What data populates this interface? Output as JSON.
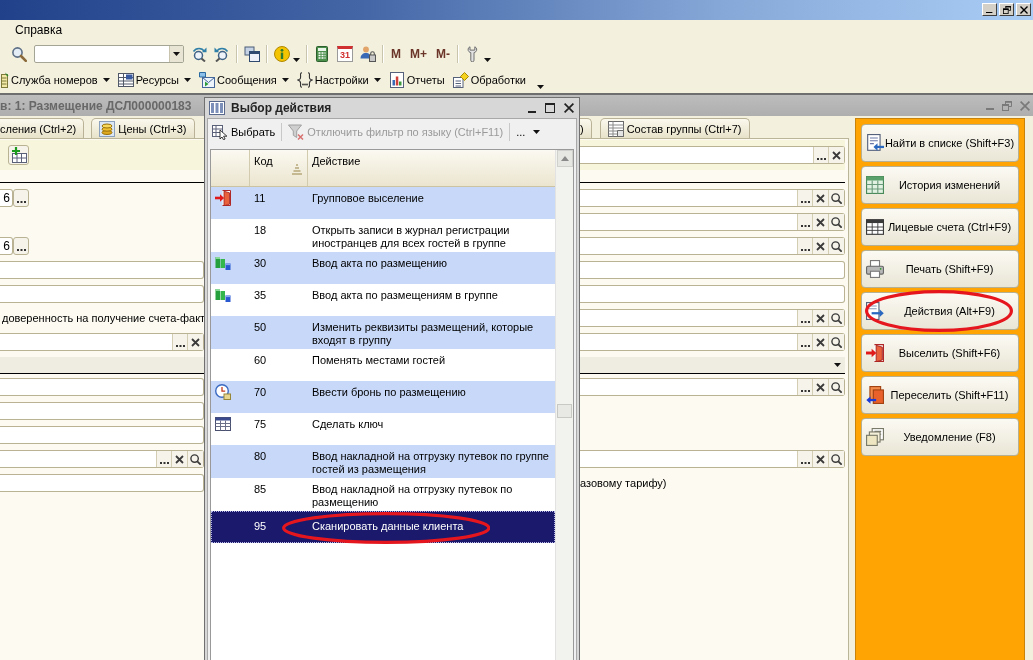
{
  "window": {
    "buttons": [
      {
        "kind": "minimize"
      },
      {
        "kind": "restore"
      },
      {
        "kind": "close"
      }
    ]
  },
  "menu": [
    {
      "label": "Справка"
    }
  ],
  "toolbar": {
    "groups": [
      [
        {
          "kind": "search",
          "dropdown": false
        },
        {
          "kind": "combo",
          "dropdown": true
        },
        {
          "kind": "findnext",
          "dropdown": false
        },
        {
          "kind": "findprev",
          "dropdown": false
        }
      ],
      [
        {
          "kind": "windows",
          "dropdown": false
        }
      ],
      [
        {
          "kind": "info",
          "dropdown": true
        }
      ],
      [
        {
          "kind": "calculator",
          "dropdown": false
        },
        {
          "kind": "calendar",
          "label": "31",
          "dropdown": false
        },
        {
          "kind": "users",
          "dropdown": false
        }
      ],
      [
        {
          "kind": "memory",
          "label": "M",
          "dropdown": false
        },
        {
          "kind": "memory",
          "label": "M+",
          "dropdown": false
        },
        {
          "kind": "memory",
          "label": "M-",
          "dropdown": false
        }
      ],
      [
        {
          "kind": "tools",
          "dropdown": true
        }
      ]
    ]
  },
  "menu_toolbar": {
    "items": [
      {
        "kind": "rooms",
        "label": "Служба номеров",
        "dropdown": true
      },
      {
        "kind": "resources",
        "label": "Ресурсы",
        "dropdown": true
      },
      {
        "kind": "messages",
        "label": "Сообщения",
        "dropdown": true
      },
      {
        "kind": "settings",
        "label": "Настройки",
        "dropdown": true
      },
      {
        "kind": "reports",
        "label": "Отчеты",
        "dropdown": false
      },
      {
        "kind": "processing",
        "label": "Обработки",
        "dropdown": false
      }
    ],
    "overflow": true
  },
  "document": {
    "title": "в: 1: Размещение ДСЛ000000183",
    "buttons": [
      {
        "kind": "minimize"
      },
      {
        "kind": "restore"
      },
      {
        "kind": "close"
      }
    ],
    "tabs": {
      "left": [
        {
          "kind": "plain",
          "label": "сления (Ctrl+2)",
          "selected": false
        },
        {
          "kind": "prices",
          "label": "Цены (Ctrl+3)",
          "selected": false
        }
      ],
      "right": [
        {
          "kind": "plain",
          "label": ")",
          "selected": false
        },
        {
          "kind": "table",
          "label": "Состав группы (Ctrl+7)",
          "selected": false
        }
      ]
    },
    "form": {
      "rows": [
        {
          "kind": "toolbar",
          "left": {
            "kind": "buttons",
            "buttons": [
              {
                "kind": "add"
              }
            ]
          },
          "right": {
            "kind": "input",
            "buttons": [
              {
                "kind": "select"
              },
              {
                "kind": "clear"
              }
            ]
          }
        },
        {
          "kind": "field",
          "left": {
            "kind": "number",
            "value": "6",
            "buttons": [
              {
                "kind": "select"
              }
            ]
          },
          "right": {
            "kind": "input",
            "buttons": [
              {
                "kind": "select"
              },
              {
                "kind": "clear"
              },
              {
                "kind": "search"
              }
            ]
          }
        },
        {
          "kind": "field",
          "right": {
            "kind": "input",
            "buttons": [
              {
                "kind": "select"
              },
              {
                "kind": "clear"
              },
              {
                "kind": "search"
              }
            ]
          }
        },
        {
          "kind": "field",
          "left": {
            "kind": "number",
            "value": "6",
            "buttons": [
              {
                "kind": "select"
              }
            ]
          },
          "right": {
            "kind": "input",
            "buttons": [
              {
                "kind": "select"
              },
              {
                "kind": "clear"
              },
              {
                "kind": "search"
              }
            ]
          }
        },
        {
          "kind": "field",
          "left": {
            "kind": "input"
          },
          "right": {
            "kind": "input"
          }
        },
        {
          "kind": "field",
          "left": {
            "kind": "input"
          },
          "right": {
            "kind": "input"
          }
        },
        {
          "kind": "field",
          "left": {
            "kind": "text",
            "text": "доверенность на получение счета-факт"
          },
          "right": {
            "kind": "input",
            "buttons": [
              {
                "kind": "select"
              },
              {
                "kind": "clear"
              },
              {
                "kind": "search"
              }
            ]
          }
        },
        {
          "kind": "field",
          "left": {
            "kind": "input",
            "buttons": [
              {
                "kind": "select"
              },
              {
                "kind": "clear"
              }
            ]
          },
          "right": {
            "kind": "input",
            "buttons": [
              {
                "kind": "select"
              },
              {
                "kind": "clear"
              },
              {
                "kind": "search"
              }
            ]
          }
        },
        {
          "kind": "band",
          "left": {
            "kind": "band",
            "dropdown": false
          },
          "right": {
            "kind": "band",
            "dropdown": true
          }
        },
        {
          "kind": "field",
          "left": {
            "kind": "input"
          },
          "right": {
            "kind": "input",
            "buttons": [
              {
                "kind": "select"
              },
              {
                "kind": "clear"
              },
              {
                "kind": "search"
              }
            ]
          }
        },
        {
          "kind": "field",
          "left": {
            "kind": "input"
          }
        },
        {
          "kind": "field",
          "left": {
            "kind": "input"
          }
        },
        {
          "kind": "field",
          "left": {
            "kind": "input",
            "buttons": [
              {
                "kind": "select"
              },
              {
                "kind": "clear"
              },
              {
                "kind": "search"
              }
            ]
          },
          "right": {
            "kind": "input",
            "buttons": [
              {
                "kind": "select"
              },
              {
                "kind": "clear"
              },
              {
                "kind": "search"
              }
            ]
          }
        },
        {
          "kind": "field",
          "left": {
            "kind": "input"
          },
          "right": {
            "kind": "text",
            "text": "азовому тарифу)"
          }
        }
      ]
    }
  },
  "panel": {
    "buttons": [
      {
        "kind": "find",
        "label": "Найти в списке (Shift+F3)",
        "highlighted": false
      },
      {
        "kind": "history",
        "label": "История изменений",
        "highlighted": false
      },
      {
        "kind": "accounts",
        "label": "Лицевые счета (Ctrl+F9)",
        "highlighted": false
      },
      {
        "kind": "print",
        "label": "Печать (Shift+F9)",
        "highlighted": false
      },
      {
        "kind": "actions",
        "label": "Действия (Alt+F9)",
        "highlighted": true
      },
      {
        "kind": "checkout",
        "label": "Выселить (Shift+F6)",
        "highlighted": false
      },
      {
        "kind": "relocate",
        "label": "Переселить (Shift+F11)",
        "highlighted": false
      },
      {
        "kind": "notify",
        "label": "Уведомление (F8)",
        "highlighted": false
      }
    ]
  },
  "dialog": {
    "title": "Выбор действия",
    "buttons": [
      {
        "kind": "minimize"
      },
      {
        "kind": "maximize"
      },
      {
        "kind": "close"
      }
    ],
    "toolbar": [
      {
        "kind": "choose",
        "label": "Выбрать",
        "disabled": false,
        "dropdown": false
      },
      {
        "kind": "filter",
        "label": "Отключить фильтр по языку (Ctrl+F11)",
        "disabled": true,
        "dropdown": false
      },
      {
        "kind": "more",
        "label": "...",
        "disabled": false,
        "dropdown": true
      }
    ],
    "columns": [
      {
        "label": "Код",
        "sorted": true
      },
      {
        "label": "Действие",
        "sorted": false
      }
    ],
    "rows": [
      {
        "kind": "exit",
        "code": "11",
        "action": "Групповое выселение",
        "selected": false,
        "highlighted": false
      },
      {
        "kind": "plain",
        "code": "18",
        "action": "Открыть записи в журнал регистрации иностранцев для всех гостей в группе",
        "selected": false,
        "highlighted": false
      },
      {
        "kind": "act",
        "code": "30",
        "action": "Ввод акта по размещению",
        "selected": false,
        "highlighted": false
      },
      {
        "kind": "act",
        "code": "35",
        "action": "Ввод акта по размещениям в группе",
        "selected": false,
        "highlighted": false
      },
      {
        "kind": "plain",
        "code": "50",
        "action": "Изменить реквизиты размещений, которые входят в группу",
        "selected": false,
        "highlighted": false
      },
      {
        "kind": "plain",
        "code": "60",
        "action": "Поменять местами гостей",
        "selected": false,
        "highlighted": false
      },
      {
        "kind": "reserve",
        "code": "70",
        "action": "Ввести бронь по размещению",
        "selected": false,
        "highlighted": false
      },
      {
        "kind": "table",
        "code": "75",
        "action": "Сделать ключ",
        "selected": false,
        "highlighted": false
      },
      {
        "kind": "plain",
        "code": "80",
        "action": "Ввод накладной на отгрузку путевок по группе гостей из размещения",
        "selected": false,
        "highlighted": false
      },
      {
        "kind": "plain",
        "code": "85",
        "action": "Ввод накладной на отгрузку путевок по размещению",
        "selected": false,
        "highlighted": false
      },
      {
        "kind": "plain",
        "code": "95",
        "action": "Сканировать данные клиента",
        "selected": true,
        "highlighted": true
      }
    ]
  }
}
